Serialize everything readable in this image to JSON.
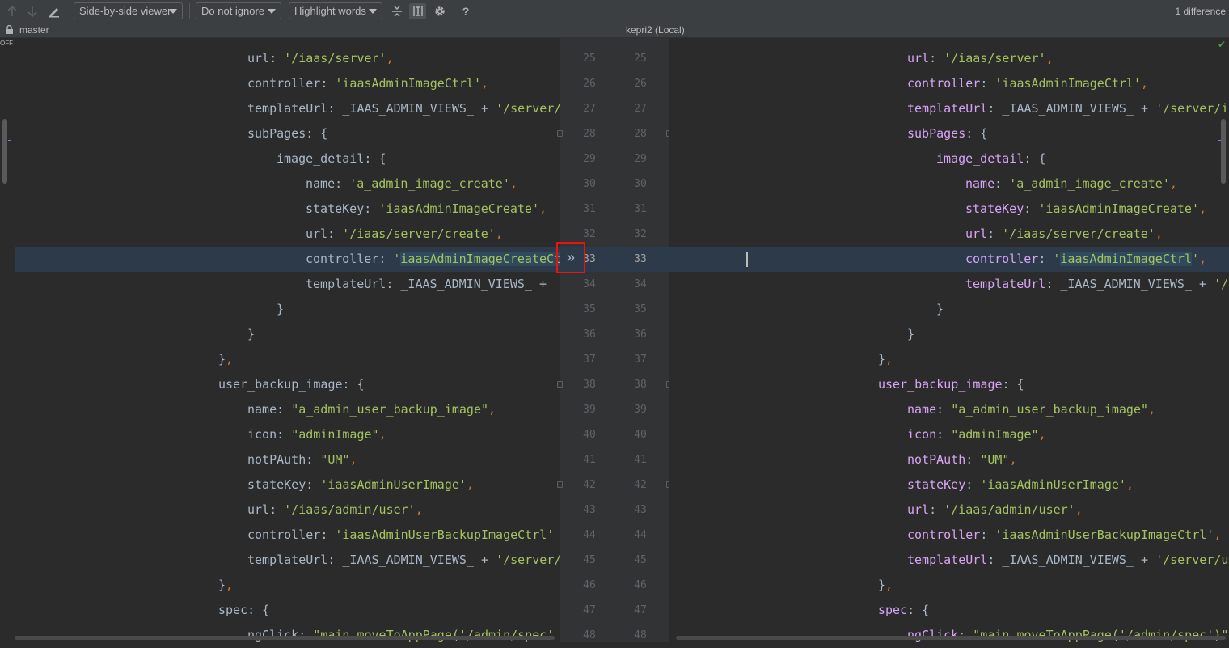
{
  "toolbar": {
    "prev_icon": "arrow-up-icon",
    "next_icon": "arrow-down-icon",
    "edit_icon": "pencil-icon",
    "viewer_mode": "Side-by-side viewer",
    "ignore_mode": "Do not ignore",
    "highlight_mode": "Highlight words",
    "collapse_icon": "collapse-unchanged-icon",
    "sync_scroll_icon": "sync-scroll-icon",
    "settings_icon": "gear-icon",
    "help_label": "?",
    "difference_count": "1 difference"
  },
  "infobar": {
    "left_branch": "master",
    "right_title": "kepri2 (Local)",
    "off_label": "OFF"
  },
  "gutter": {
    "apply_label": "»"
  },
  "line_numbers": [
    25,
    26,
    27,
    28,
    29,
    30,
    31,
    32,
    33,
    34,
    35,
    36,
    37,
    38,
    39,
    40,
    41,
    42,
    43,
    44,
    45,
    46,
    47,
    48
  ],
  "left_lines": [
    [
      [
        "k",
        "url"
      ],
      [
        "pl",
        ": "
      ],
      [
        "s",
        "'/iaas/server'"
      ],
      [
        "p",
        ","
      ]
    ],
    [
      [
        "k",
        "controller"
      ],
      [
        "pl",
        ": "
      ],
      [
        "s",
        "'iaasAdminImageCtrl'"
      ],
      [
        "p",
        ","
      ]
    ],
    [
      [
        "k",
        "templateUrl"
      ],
      [
        "pl",
        ": _IAAS_ADMIN_VIEWS_ + "
      ],
      [
        "s",
        "'/server/"
      ]
    ],
    [
      [
        "k",
        "subPages"
      ],
      [
        "pl",
        ": {"
      ]
    ],
    [
      [
        "k",
        "image_detail"
      ],
      [
        "pl",
        ": {"
      ]
    ],
    [
      [
        "k",
        "name"
      ],
      [
        "pl",
        ": "
      ],
      [
        "s",
        "'a_admin_image_create'"
      ],
      [
        "p",
        ","
      ]
    ],
    [
      [
        "k",
        "stateKey"
      ],
      [
        "pl",
        ": "
      ],
      [
        "s",
        "'iaasAdminImageCreate'"
      ],
      [
        "p",
        ","
      ]
    ],
    [
      [
        "k",
        "url"
      ],
      [
        "pl",
        ": "
      ],
      [
        "s",
        "'/iaas/server/create'"
      ],
      [
        "p",
        ","
      ]
    ],
    [
      [
        "k",
        "controller"
      ],
      [
        "pl",
        ": "
      ],
      [
        "s",
        "'"
      ],
      [
        "sh",
        "iaasAdminImageCreateCtrl"
      ]
    ],
    [
      [
        "k",
        "templateUrl"
      ],
      [
        "pl",
        ": _IAAS_ADMIN_VIEWS_ +"
      ]
    ],
    [
      [
        "pl",
        "}"
      ]
    ],
    [
      [
        "pl",
        "}"
      ]
    ],
    [
      [
        "pl",
        "}"
      ],
      [
        "p",
        ","
      ]
    ],
    [
      [
        "k",
        "user_backup_image"
      ],
      [
        "pl",
        ": {"
      ]
    ],
    [
      [
        "k",
        "name"
      ],
      [
        "pl",
        ": "
      ],
      [
        "s",
        "\"a_admin_user_backup_image\""
      ],
      [
        "p",
        ","
      ]
    ],
    [
      [
        "k",
        "icon"
      ],
      [
        "pl",
        ": "
      ],
      [
        "s",
        "\"adminImage\""
      ],
      [
        "p",
        ","
      ]
    ],
    [
      [
        "k",
        "notPAuth"
      ],
      [
        "pl",
        ": "
      ],
      [
        "s",
        "\"UM\""
      ],
      [
        "p",
        ","
      ]
    ],
    [
      [
        "k",
        "stateKey"
      ],
      [
        "pl",
        ": "
      ],
      [
        "s",
        "'iaasAdminUserImage'"
      ],
      [
        "p",
        ","
      ]
    ],
    [
      [
        "k",
        "url"
      ],
      [
        "pl",
        ": "
      ],
      [
        "s",
        "'/iaas/admin/user'"
      ],
      [
        "p",
        ","
      ]
    ],
    [
      [
        "k",
        "controller"
      ],
      [
        "pl",
        ": "
      ],
      [
        "s",
        "'iaasAdminUserBackupImageCtrl'"
      ]
    ],
    [
      [
        "k",
        "templateUrl"
      ],
      [
        "pl",
        ": _IAAS_ADMIN_VIEWS_ + "
      ],
      [
        "s",
        "'/server/"
      ]
    ],
    [
      [
        "pl",
        "}"
      ],
      [
        "p",
        ","
      ]
    ],
    [
      [
        "k",
        "spec"
      ],
      [
        "pl",
        ": {"
      ]
    ],
    [
      [
        "k",
        "ngClick"
      ],
      [
        "pl",
        ": "
      ],
      [
        "s",
        "\"main.moveToAppPage('/admin/spec'"
      ]
    ]
  ],
  "right_lines": [
    [
      [
        "rk",
        "url"
      ],
      [
        "pl",
        ": "
      ],
      [
        "s",
        "'/iaas/server'"
      ],
      [
        "p",
        ","
      ]
    ],
    [
      [
        "rk",
        "controller"
      ],
      [
        "pl",
        ": "
      ],
      [
        "s",
        "'iaasAdminImageCtrl'"
      ],
      [
        "p",
        ","
      ]
    ],
    [
      [
        "rk",
        "templateUrl"
      ],
      [
        "pl",
        ": _IAAS_ADMIN_VIEWS_ + "
      ],
      [
        "s",
        "'/server/im"
      ]
    ],
    [
      [
        "rk",
        "subPages"
      ],
      [
        "pl",
        ": {"
      ]
    ],
    [
      [
        "rk",
        "image_detail"
      ],
      [
        "pl",
        ": {"
      ]
    ],
    [
      [
        "rk",
        "name"
      ],
      [
        "pl",
        ": "
      ],
      [
        "s",
        "'a_admin_image_create'"
      ],
      [
        "p",
        ","
      ]
    ],
    [
      [
        "rk",
        "stateKey"
      ],
      [
        "pl",
        ": "
      ],
      [
        "s",
        "'iaasAdminImageCreate'"
      ],
      [
        "p",
        ","
      ]
    ],
    [
      [
        "rk",
        "url"
      ],
      [
        "pl",
        ": "
      ],
      [
        "s",
        "'/iaas/server/create'"
      ],
      [
        "p",
        ","
      ]
    ],
    [
      [
        "rk",
        "controller"
      ],
      [
        "pl",
        ": "
      ],
      [
        "s",
        "'"
      ],
      [
        "sh",
        "iaasAdminImageCtrl"
      ],
      [
        "s",
        "'"
      ],
      [
        "p",
        ","
      ]
    ],
    [
      [
        "rk",
        "templateUrl"
      ],
      [
        "pl",
        ": _IAAS_ADMIN_VIEWS_ + "
      ],
      [
        "s",
        "'/s"
      ]
    ],
    [
      [
        "pl",
        "}"
      ]
    ],
    [
      [
        "pl",
        "}"
      ]
    ],
    [
      [
        "pl",
        "}"
      ],
      [
        "p",
        ","
      ]
    ],
    [
      [
        "rk",
        "user_backup_image"
      ],
      [
        "pl",
        ": {"
      ]
    ],
    [
      [
        "rk",
        "name"
      ],
      [
        "pl",
        ": "
      ],
      [
        "s",
        "\"a_admin_user_backup_image\""
      ],
      [
        "p",
        ","
      ]
    ],
    [
      [
        "rk",
        "icon"
      ],
      [
        "pl",
        ": "
      ],
      [
        "s",
        "\"adminImage\""
      ],
      [
        "p",
        ","
      ]
    ],
    [
      [
        "rk",
        "notPAuth"
      ],
      [
        "pl",
        ": "
      ],
      [
        "s",
        "\"UM\""
      ],
      [
        "p",
        ","
      ]
    ],
    [
      [
        "rk",
        "stateKey"
      ],
      [
        "pl",
        ": "
      ],
      [
        "s",
        "'iaasAdminUserImage'"
      ],
      [
        "p",
        ","
      ]
    ],
    [
      [
        "rk",
        "url"
      ],
      [
        "pl",
        ": "
      ],
      [
        "s",
        "'/iaas/admin/user'"
      ],
      [
        "p",
        ","
      ]
    ],
    [
      [
        "rk",
        "controller"
      ],
      [
        "pl",
        ": "
      ],
      [
        "s",
        "'iaasAdminUserBackupImageCtrl'"
      ],
      [
        "p",
        ","
      ]
    ],
    [
      [
        "rk",
        "templateUrl"
      ],
      [
        "pl",
        ": _IAAS_ADMIN_VIEWS_ + "
      ],
      [
        "s",
        "'/server/us"
      ]
    ],
    [
      [
        "pl",
        "}"
      ],
      [
        "p",
        ","
      ]
    ],
    [
      [
        "rk",
        "spec"
      ],
      [
        "pl",
        ": {"
      ]
    ],
    [
      [
        "rk",
        "ngClick"
      ],
      [
        "pl",
        ": "
      ],
      [
        "s",
        "\"main.moveToAppPage('/admin/spec')\""
      ]
    ]
  ],
  "indent_levels": [
    1,
    1,
    1,
    1,
    2,
    3,
    3,
    3,
    3,
    3,
    2,
    1,
    0,
    0,
    1,
    1,
    1,
    1,
    1,
    1,
    1,
    0,
    0,
    1
  ],
  "highlighted_line": 33
}
